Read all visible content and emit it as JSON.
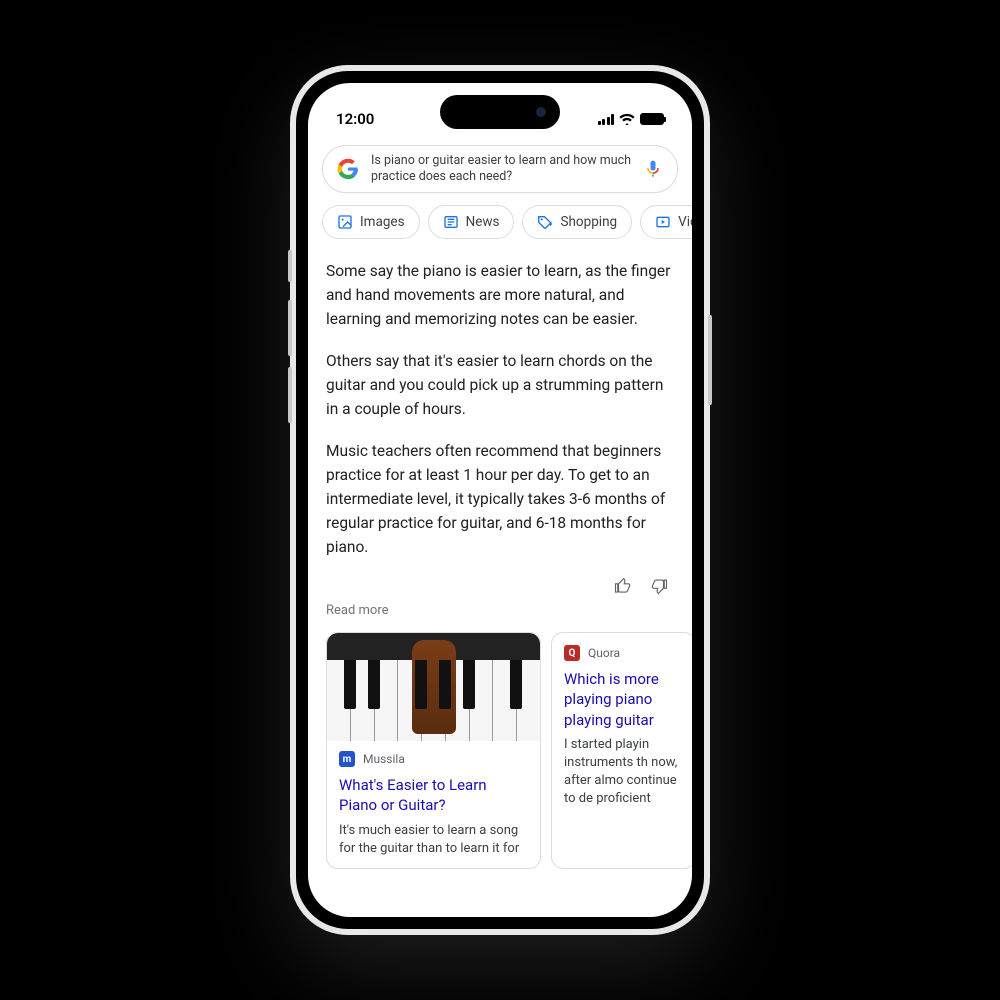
{
  "status": {
    "time": "12:00"
  },
  "search": {
    "query": "Is piano or guitar easier to learn and how much practice does each need?"
  },
  "chips": [
    {
      "label": "Images"
    },
    {
      "label": "News"
    },
    {
      "label": "Shopping"
    },
    {
      "label": "Videos"
    }
  ],
  "answer": {
    "p1": "Some say the piano is easier to learn, as the finger and hand movements are more natural, and learning and memorizing notes can be easier.",
    "p2": "Others say that it's easier to learn chords on the guitar and you could pick up a strumming pattern in a couple of hours.",
    "p3": "Music teachers often recommend that beginners practice for at least 1 hour per day. To get to an intermediate level, it typically takes 3-6 months of regular practice for guitar, and 6-18 months for piano."
  },
  "readMore": "Read more",
  "cards": [
    {
      "source": "Mussila",
      "title": "What's Easier to Learn Piano or Guitar?",
      "snippet": "It's much easier to learn a song for the guitar than to learn it for"
    },
    {
      "source": "Quora",
      "title": "Which is more playing piano playing guitar",
      "snippet": "I started playin instruments th now, after almo continue to de proficient"
    }
  ]
}
